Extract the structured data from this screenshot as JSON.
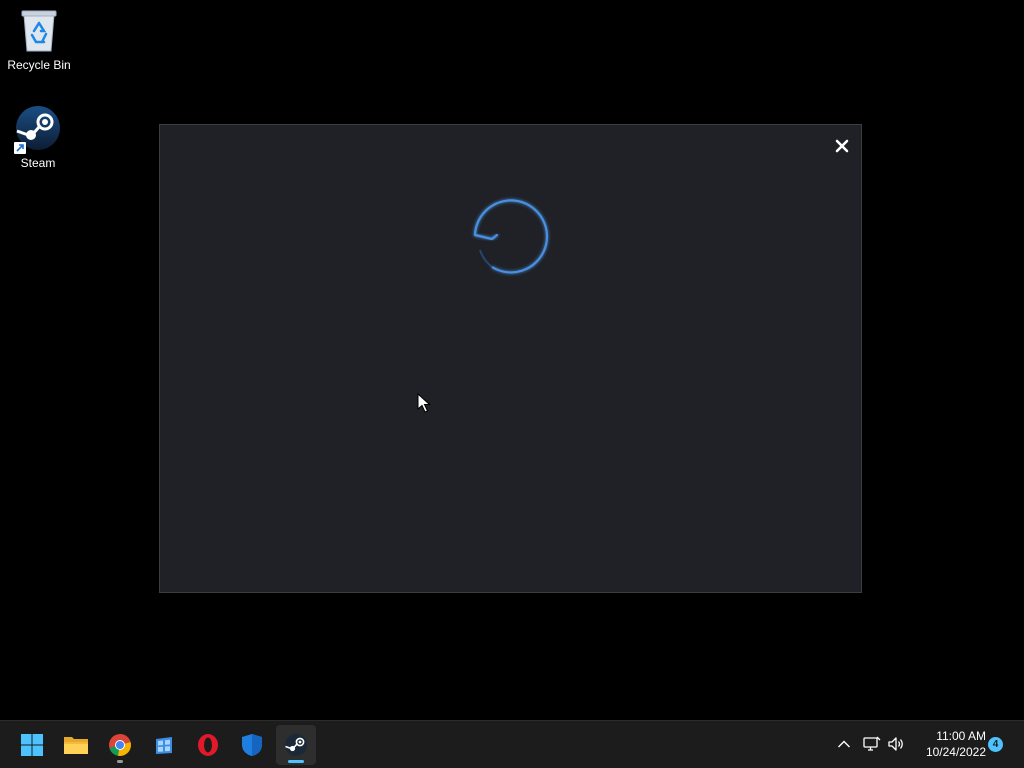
{
  "desktop": {
    "icons": [
      {
        "label": "Recycle Bin",
        "icon": "recycle-bin-icon"
      },
      {
        "label": "Steam",
        "icon": "steam-icon"
      }
    ]
  },
  "steam_window": {
    "state": "loading",
    "close_icon": "close-icon",
    "spinner_icon": "steam-spinner-icon",
    "accent_color": "#4a90e2"
  },
  "taskbar": {
    "apps": [
      {
        "name": "Start",
        "icon": "windows-start-icon"
      },
      {
        "name": "File Explorer",
        "icon": "folder-icon"
      },
      {
        "name": "Google Chrome",
        "icon": "chrome-icon"
      },
      {
        "name": "Microsoft Store-like app",
        "icon": "store-icon"
      },
      {
        "name": "Opera",
        "icon": "opera-icon"
      },
      {
        "name": "Windows Security",
        "icon": "shield-icon"
      },
      {
        "name": "Steam",
        "icon": "steam-icon"
      }
    ],
    "tray": {
      "overflow_icon": "chevron-up-icon",
      "network_icon": "network-icon",
      "volume_icon": "volume-icon",
      "time": "11:00 AM",
      "date": "10/24/2022",
      "notification_count": "4",
      "accent_color": "#4cc2ff"
    }
  }
}
